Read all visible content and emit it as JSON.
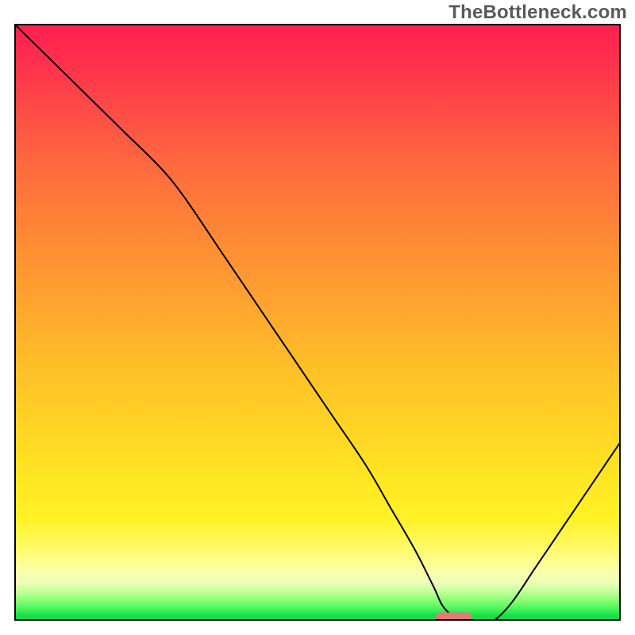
{
  "watermark": "TheBottleneck.com",
  "colors": {
    "curve": "#000000",
    "marker": "#e37a74",
    "frame": "#000000"
  },
  "chart_data": {
    "type": "line",
    "title": "",
    "xlabel": "",
    "ylabel": "",
    "xlim": [
      0,
      100
    ],
    "ylim": [
      0,
      100
    ],
    "grid": false,
    "legend": false,
    "series": [
      {
        "name": "curve",
        "x": [
          0,
          6,
          12,
          18,
          24,
          28,
          34,
          40,
          46,
          52,
          58,
          62,
          66,
          69,
          71,
          74,
          77,
          79,
          82,
          86,
          90,
          94,
          98,
          100
        ],
        "y": [
          100,
          94,
          88,
          82,
          76,
          71,
          62,
          53,
          44,
          35,
          26,
          19,
          12,
          6,
          2,
          0,
          0,
          0,
          3,
          9,
          15,
          21,
          27,
          30
        ]
      }
    ],
    "marker": {
      "shape": "rounded-rect",
      "x_center": 72.5,
      "x_halfwidth": 3,
      "y": 0,
      "color": "#e37a74"
    },
    "gradient_stops": [
      {
        "pos": 0.0,
        "color": "#ff1f52"
      },
      {
        "pos": 0.24,
        "color": "#ff6a3e"
      },
      {
        "pos": 0.48,
        "color": "#ffa72e"
      },
      {
        "pos": 0.68,
        "color": "#ffd524"
      },
      {
        "pos": 0.88,
        "color": "#fffb6b"
      },
      {
        "pos": 0.95,
        "color": "#c9ff9f"
      },
      {
        "pos": 1.0,
        "color": "#0fd644"
      }
    ]
  }
}
